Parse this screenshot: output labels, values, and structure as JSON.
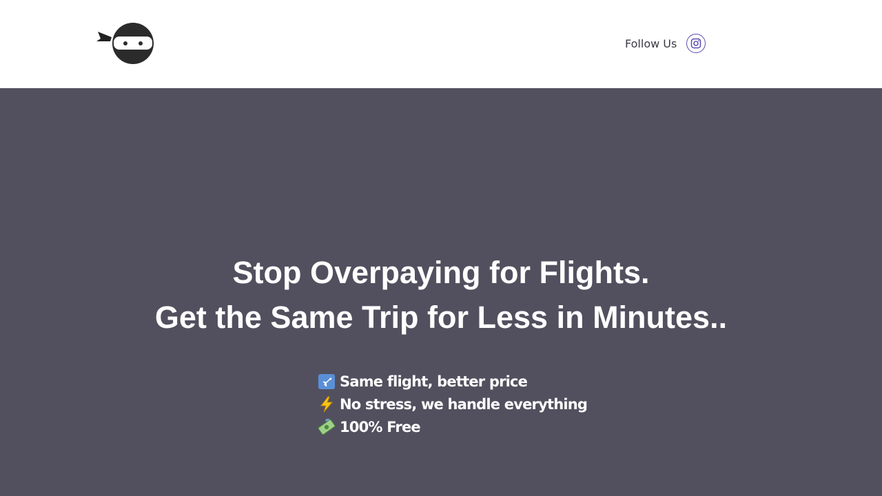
{
  "header": {
    "logo_icon": "ninja-head-icon",
    "follow_label": "Follow Us",
    "social_icon": "instagram-icon",
    "social_color": "#5b4bb0"
  },
  "hero": {
    "background": "#52505e",
    "headline_line1": "Stop Overpaying for Flights.",
    "headline_line2": "Get the Same Trip for Less in Minutes..",
    "features": [
      {
        "icon": "airplane-icon",
        "text": "Same flight, better price"
      },
      {
        "icon": "lightning-icon",
        "text": "No stress, we handle everything"
      },
      {
        "icon": "money-icon",
        "text": "100% Free"
      }
    ]
  }
}
